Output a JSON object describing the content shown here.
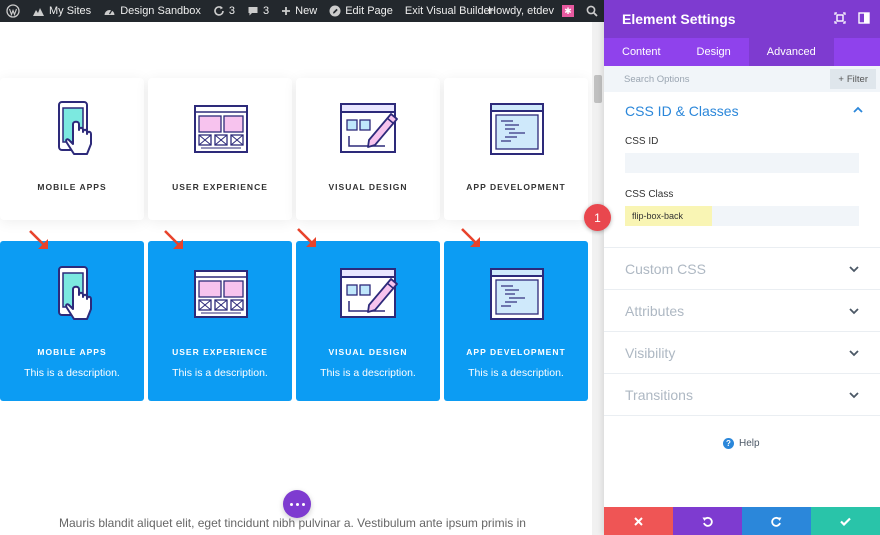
{
  "admin_bar": {
    "my_sites": "My Sites",
    "site_name": "Design Sandbox",
    "updates_count": "3",
    "comments_count": "3",
    "new_label": "New",
    "edit_page": "Edit Page",
    "exit_builder": "Exit Visual Builder",
    "howdy": "Howdy, etdev"
  },
  "cards": [
    {
      "title": "MOBILE APPS",
      "description": "This is a description.",
      "icon": "mobile-hand-icon"
    },
    {
      "title": "USER EXPERIENCE",
      "description": "This is a description.",
      "icon": "wireframe-icon"
    },
    {
      "title": "VISUAL DESIGN",
      "description": "This is a description.",
      "icon": "design-pencil-icon"
    },
    {
      "title": "APP DEVELOPMENT",
      "description": "This is a description.",
      "icon": "code-window-icon"
    }
  ],
  "body_text": "Mauris blandit aliquet elit, eget tincidunt nibh pulvinar a. Vestibulum ante ipsum primis in",
  "panel": {
    "title": "Element Settings",
    "tabs": [
      "Content",
      "Design",
      "Advanced"
    ],
    "active_tab": "Advanced",
    "search_placeholder": "Search Options",
    "filter_label": "Filter",
    "open_section": {
      "title": "CSS ID & Classes",
      "css_id_label": "CSS ID",
      "css_id_value": "",
      "css_class_label": "CSS Class",
      "css_class_value": "flip-box-back"
    },
    "sections": [
      "Custom CSS",
      "Attributes",
      "Visibility",
      "Transitions"
    ],
    "help": "Help"
  },
  "callout_number": "1",
  "colors": {
    "purple": "#7e3bd0",
    "purple_tabs": "#8f42ec",
    "card_blue": "#0c9cf3",
    "section_blue": "#2b87da",
    "discard": "#ef5555",
    "undo": "#7e3bd0",
    "redo": "#2b87da",
    "save": "#29c4a9",
    "arrow_red": "#e8432b",
    "highlight": "#f9f5b4"
  }
}
